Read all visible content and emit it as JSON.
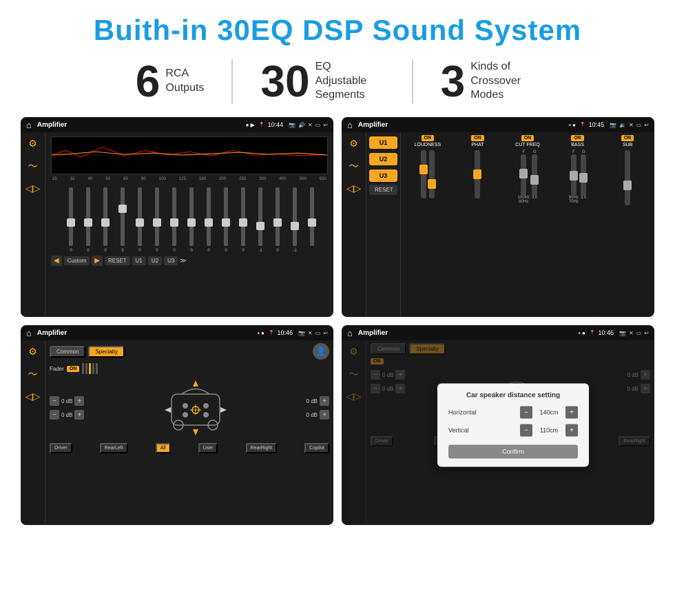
{
  "title": "Buith-in 30EQ DSP Sound System",
  "stats": [
    {
      "number": "6",
      "label": "RCA\nOutputs"
    },
    {
      "number": "30",
      "label": "EQ Adjustable\nSegments"
    },
    {
      "number": "3",
      "label": "Kinds of\nCrossover Modes"
    }
  ],
  "screens": [
    {
      "id": "eq-screen",
      "title": "Amplifier",
      "time": "10:44",
      "type": "eq"
    },
    {
      "id": "crossover-screen",
      "title": "Amplifier",
      "time": "10:45",
      "type": "crossover"
    },
    {
      "id": "fader-screen",
      "title": "Amplifier",
      "time": "10:46",
      "type": "fader"
    },
    {
      "id": "distance-screen",
      "title": "Amplifier",
      "time": "10:46",
      "type": "distance"
    }
  ],
  "eq": {
    "freqs": [
      "25",
      "32",
      "40",
      "50",
      "63",
      "80",
      "100",
      "125",
      "160",
      "200",
      "250",
      "320",
      "400",
      "500",
      "630"
    ],
    "values": [
      "0",
      "0",
      "0",
      "5",
      "0",
      "0",
      "0",
      "0",
      "0",
      "0",
      "0",
      "-1",
      "0",
      "-1",
      ""
    ],
    "preset": "Custom",
    "buttons": [
      "RESET",
      "U1",
      "U2",
      "U3"
    ]
  },
  "crossover": {
    "u_buttons": [
      "U1",
      "U2",
      "U3"
    ],
    "reset": "RESET",
    "controls": [
      "LOUDNESS",
      "PHAT",
      "CUT FREQ",
      "BASS",
      "SUB"
    ]
  },
  "fader": {
    "tabs": [
      "Common",
      "Specialty"
    ],
    "fader_label": "Fader",
    "on_label": "ON",
    "db_values": [
      "0 dB",
      "0 dB",
      "0 dB",
      "0 dB"
    ],
    "bottom_buttons": [
      "Driver",
      "RearLeft",
      "All",
      "User",
      "RearRight",
      "Copilot"
    ]
  },
  "distance_dialog": {
    "title": "Car speaker distance setting",
    "horizontal_label": "Horizontal",
    "horizontal_value": "140cm",
    "vertical_label": "Vertical",
    "vertical_value": "110cm",
    "confirm_label": "Confirm"
  }
}
